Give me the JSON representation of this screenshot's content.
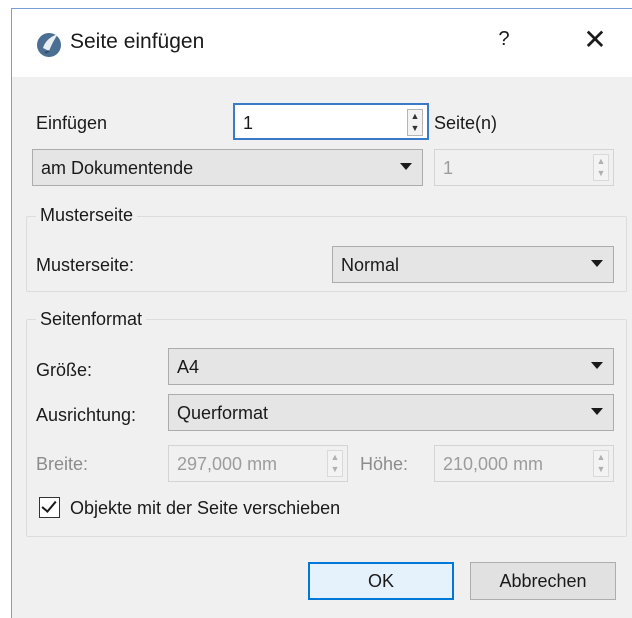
{
  "window": {
    "title": "Seite einfügen",
    "help_label": "?",
    "close_label": "✕"
  },
  "insert": {
    "label": "Einfügen",
    "count_value": "1",
    "unit_label": "Seite(n)",
    "position_selected": "am Dokumentende",
    "page_value": "1"
  },
  "master": {
    "group_title": "Musterseite",
    "label": "Musterseite:",
    "selected": "Normal"
  },
  "format": {
    "group_title": "Seitenformat",
    "size_label": "Größe:",
    "size_selected": "A4",
    "orientation_label": "Ausrichtung:",
    "orientation_selected": "Querformat",
    "width_label": "Breite:",
    "width_value": "297,000 mm",
    "height_label": "Höhe:",
    "height_value": "210,000 mm"
  },
  "move_objects": {
    "label": "Objekte mit der Seite verschieben",
    "checked": true
  },
  "buttons": {
    "ok": "OK",
    "cancel": "Abbrechen"
  }
}
